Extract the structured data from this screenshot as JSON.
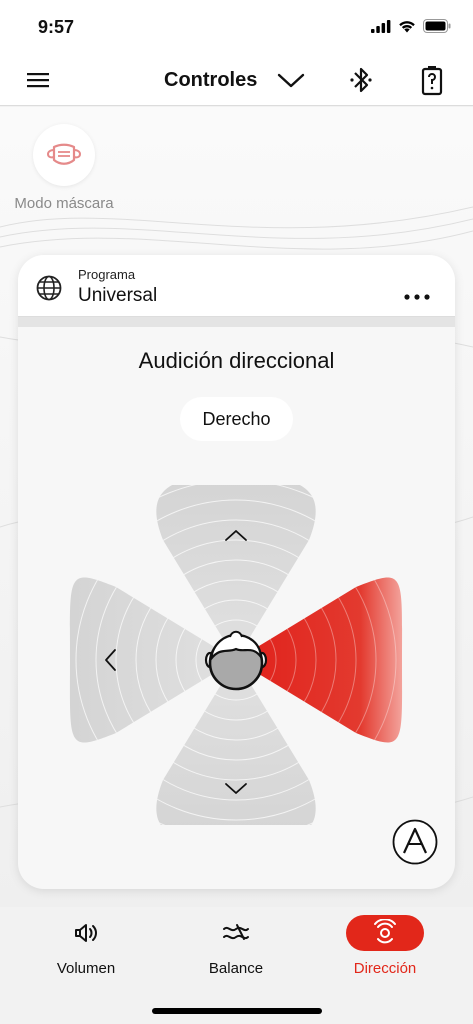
{
  "status": {
    "time": "9:57"
  },
  "topbar": {
    "title": "Controles"
  },
  "mask": {
    "label": "Modo máscara"
  },
  "program": {
    "small_label": "Programa",
    "name": "Universal"
  },
  "direction": {
    "title": "Audición direccional",
    "side": "Derecho",
    "selected": "right"
  },
  "tabs": [
    {
      "label": "Volumen",
      "icon": "speaker-icon",
      "active": false
    },
    {
      "label": "Balance",
      "icon": "balance-waves-icon",
      "active": false
    },
    {
      "label": "Dirección",
      "icon": "direction-icon",
      "active": true
    }
  ],
  "colors": {
    "accent": "#e2271a",
    "inactive_lobe": "#d6d6d6"
  }
}
